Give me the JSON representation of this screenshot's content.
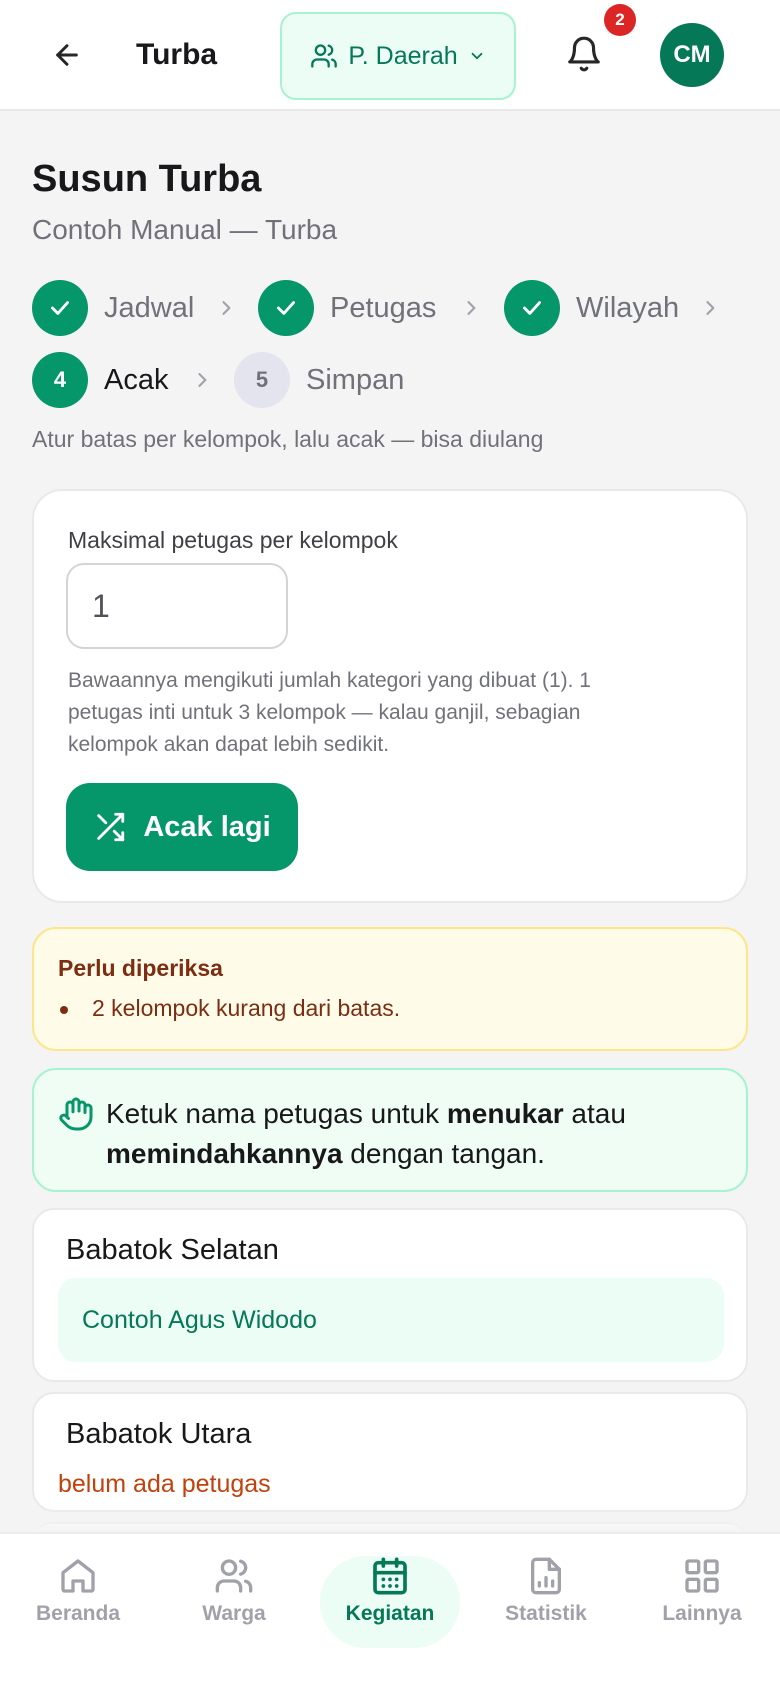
{
  "header": {
    "title": "Turba",
    "scope_label": "P. Daerah",
    "notification_count": "2",
    "avatar_initials": "CM"
  },
  "page": {
    "title": "Susun Turba",
    "subtitle": "Contoh Manual — Turba",
    "hint": "Atur batas per kelompok, lalu acak — bisa diulang"
  },
  "steps": [
    {
      "number": "1",
      "label": "Jadwal",
      "status": "done"
    },
    {
      "number": "2",
      "label": "Petugas",
      "status": "done"
    },
    {
      "number": "3",
      "label": "Wilayah",
      "status": "done"
    },
    {
      "number": "4",
      "label": "Acak",
      "status": "active"
    },
    {
      "number": "5",
      "label": "Simpan",
      "status": "pending"
    }
  ],
  "settings": {
    "field_label": "Maksimal petugas per kelompok",
    "field_value": "1",
    "help_text": "Bawaannya mengikuti jumlah kategori yang dibuat (1). 1 petugas inti untuk 3 kelompok — kalau ganjil, sebagian kelompok akan dapat lebih sedikit.",
    "shuffle_label": "Acak lagi"
  },
  "warning": {
    "title": "Perlu diperiksa",
    "items": [
      "2 kelompok kurang dari batas."
    ]
  },
  "info": {
    "text_1": "Ketuk nama petugas untuk ",
    "bold_1": "menukar",
    "text_2": " atau ",
    "bold_2": "memindahkannya",
    "text_3": " dengan tangan."
  },
  "groups": [
    {
      "name": "Babatok Selatan",
      "members": [
        "Contoh Agus Widodo"
      ],
      "empty_text": ""
    },
    {
      "name": "Babatok Utara",
      "members": [],
      "empty_text": "belum ada petugas"
    }
  ],
  "bottom_nav": [
    {
      "label": "Beranda",
      "icon": "home-icon",
      "active": false
    },
    {
      "label": "Warga",
      "icon": "users-icon",
      "active": false
    },
    {
      "label": "Kegiatan",
      "icon": "calendar-icon",
      "active": true
    },
    {
      "label": "Statistik",
      "icon": "chart-icon",
      "active": false
    },
    {
      "label": "Lainnya",
      "icon": "grid-icon",
      "active": false
    }
  ],
  "colors": {
    "brand": "#059669",
    "brand_dark": "#047857",
    "warning_bg": "#fefce8",
    "warning_text": "#7c2d12",
    "empty_text": "#c2410c",
    "badge": "#dc2626"
  }
}
